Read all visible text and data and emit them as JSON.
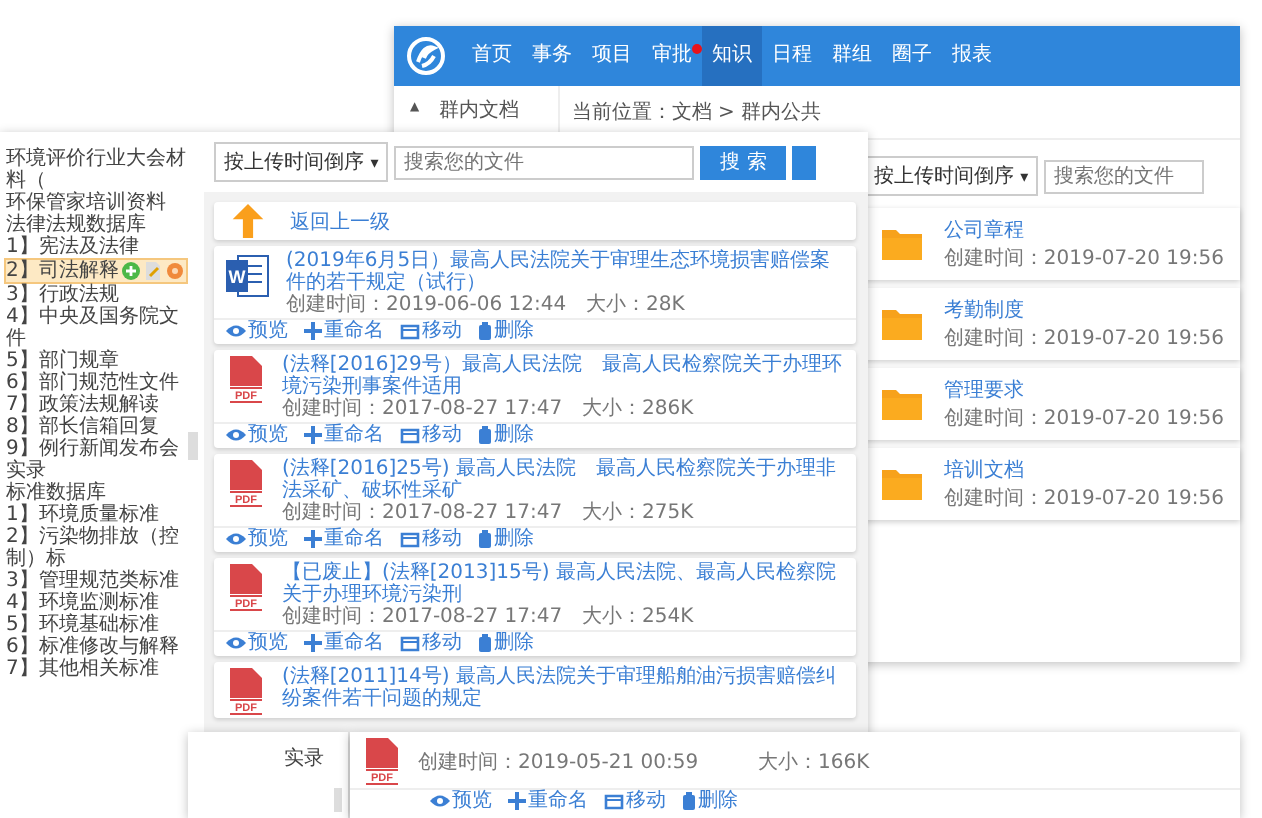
{
  "knowledge_window": {
    "nav": [
      {
        "label": "首页",
        "selected": false,
        "notify": false
      },
      {
        "label": "事务",
        "selected": false,
        "notify": false
      },
      {
        "label": "项目",
        "selected": false,
        "notify": false
      },
      {
        "label": "审批",
        "selected": false,
        "notify": true
      },
      {
        "label": "知识",
        "selected": true,
        "notify": false
      },
      {
        "label": "日程",
        "selected": false,
        "notify": false
      },
      {
        "label": "群组",
        "selected": false,
        "notify": false
      },
      {
        "label": "圈子",
        "selected": false,
        "notify": false
      },
      {
        "label": "报表",
        "selected": false,
        "notify": false
      }
    ],
    "sidebar": {
      "caret": "▲",
      "label": "群内文档"
    },
    "breadcrumb": "当前位置：文档 > 群内公共",
    "sort": "按上传时间倒序",
    "sort_caret": "▾",
    "search": {
      "placeholder": "搜索您的文件"
    },
    "folders": [
      {
        "name": "公司章程",
        "created": "创建时间：2019-07-20 19:56"
      },
      {
        "name": "考勤制度",
        "created": "创建时间：2019-07-20 19:56"
      },
      {
        "name": "管理要求",
        "created": "创建时间：2019-07-20 19:56"
      },
      {
        "name": "培训文档",
        "created": "创建时间：2019-07-20 19:56"
      }
    ]
  },
  "library_window": {
    "tree": [
      {
        "label": "环境评价行业大会材料（",
        "selected": false
      },
      {
        "label": "环保管家培训资料",
        "selected": false
      },
      {
        "label": "法律法规数据库",
        "selected": false,
        "children": [
          {
            "label": "1】宪法及法律",
            "selected": false
          },
          {
            "label": "2】司法解释",
            "selected": true
          },
          {
            "label": "3】行政法规",
            "selected": false
          },
          {
            "label": "4】中央及国务院文件",
            "selected": false
          },
          {
            "label": "5】部门规章",
            "selected": false
          },
          {
            "label": "6】部门规范性文件",
            "selected": false
          },
          {
            "label": "7】政策法规解读",
            "selected": false
          },
          {
            "label": "8】部长信箱回复",
            "selected": false
          },
          {
            "label": "9】例行新闻发布会实录",
            "selected": false
          }
        ]
      },
      {
        "label": "标准数据库",
        "selected": false,
        "children": [
          {
            "label": "1】环境质量标准",
            "selected": false
          },
          {
            "label": "2】污染物排放（控制）标",
            "selected": false
          },
          {
            "label": "3】管理规范类标准",
            "selected": false
          },
          {
            "label": "4】环境监测标准",
            "selected": false
          },
          {
            "label": "5】环境基础标准",
            "selected": false
          },
          {
            "label": "6】标准修改与解释",
            "selected": false
          },
          {
            "label": "7】其他相关标准",
            "selected": false
          }
        ]
      }
    ],
    "sort": "按上传时间倒序",
    "sort_caret": "▾",
    "search": {
      "placeholder": "搜索您的文件"
    },
    "search_button": "搜 索",
    "back": "返回上一级",
    "files": [
      {
        "kind": "word",
        "badge": "W",
        "title": "(2019年6月5日）最高人民法院关于审理生态环境损害赔偿案件的若干规定（试行）",
        "created": "创建时间：2019-06-06 12:44",
        "size": "大小：28K",
        "actions": [
          "预览",
          "重命名",
          "移动",
          "删除"
        ]
      },
      {
        "kind": "pdf",
        "badge": "PDF",
        "title": "(法释[2016]29号）最高人民法院　最高人民检察院关于办理环境污染刑事案件适用",
        "created": "创建时间：2017-08-27 17:47",
        "size": "大小：286K",
        "actions": [
          "预览",
          "重命名",
          "移动",
          "删除"
        ]
      },
      {
        "kind": "pdf",
        "badge": "PDF",
        "title": "(法释[2016]25号) 最高人民法院　最高人民检察院关于办理非法采矿、破坏性采矿",
        "created": "创建时间：2017-08-27 17:47",
        "size": "大小：275K",
        "actions": [
          "预览",
          "重命名",
          "移动",
          "删除"
        ]
      },
      {
        "kind": "pdf",
        "badge": "PDF",
        "title": "【已废止】(法释[2013]15号) 最高人民法院、最高人民检察院关于办理环境污染刑",
        "created": "创建时间：2017-08-27 17:47",
        "size": "大小：254K",
        "actions": [
          "预览",
          "重命名",
          "移动",
          "删除"
        ]
      },
      {
        "kind": "pdf",
        "badge": "PDF",
        "title": "(法释[2011]14号) 最高人民法院关于审理船舶油污损害赔偿纠纷案件若干问题的规定"
      }
    ]
  },
  "side_fragment": {
    "text": "实录"
  },
  "front_window": {
    "file": {
      "kind": "pdf",
      "badge": "PDF",
      "created": "创建时间：2019-05-21 00:59",
      "size": "大小：166K",
      "actions": [
        "预览",
        "重命名",
        "移动",
        "删除"
      ]
    }
  }
}
